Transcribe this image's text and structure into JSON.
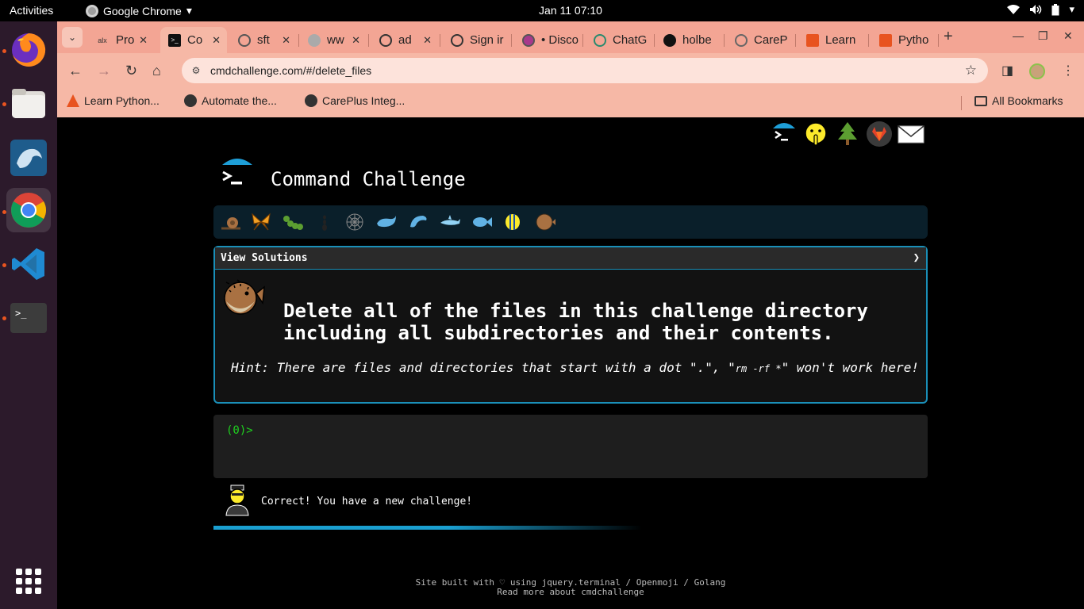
{
  "system": {
    "activities": "Activities",
    "app_name": "Google Chrome",
    "clock": "Jan 11  07:10"
  },
  "browser": {
    "tabs": [
      {
        "title": "Pro",
        "favicon": "alx-icon"
      },
      {
        "title": "Co",
        "favicon": "terminal-icon",
        "active": true
      },
      {
        "title": "sft",
        "favicon": "globe-icon"
      },
      {
        "title": "ww",
        "favicon": "globe-icon"
      },
      {
        "title": "ad",
        "favicon": "github-copilot-icon"
      },
      {
        "title": "Sign ir",
        "favicon": "github-copilot-icon"
      },
      {
        "title": "• Disco",
        "favicon": "discord-icon"
      },
      {
        "title": "ChatG",
        "favicon": "chatgpt-icon"
      },
      {
        "title": "holbe",
        "favicon": "github-icon"
      },
      {
        "title": "CareP",
        "favicon": "carepoint-icon"
      },
      {
        "title": "Learn",
        "favicon": "alx-flame-icon"
      },
      {
        "title": "Pytho",
        "favicon": "alx-flame-icon"
      }
    ],
    "url": "cmdchallenge.com/#/delete_files",
    "bookmarks": [
      {
        "label": "Learn Python...",
        "icon": "flame-icon"
      },
      {
        "label": "Automate the...",
        "icon": "globe-icon"
      },
      {
        "label": "CarePlus Integ...",
        "icon": "globe-icon"
      }
    ],
    "all_bookmarks": "All Bookmarks"
  },
  "page": {
    "site_title": "Command Challenge",
    "view_solutions": "View Solutions",
    "chevron": "❯",
    "task_line1": "Delete all of the files in this challenge directory",
    "task_line2": "including all subdirectories and their contents.",
    "hint_prefix": "Hint: There are files and directories that start with a dot \".\", \"",
    "hint_code": "rm -rf *",
    "hint_suffix": "\" won't work here!",
    "prompt": "(0)>",
    "message": "Correct! You have a new challenge!",
    "footer_line1": "Site built with ♡ using jquery.terminal / Openmoji / Golang",
    "footer_line2": "Read more about cmdchallenge",
    "progress": 0.6
  }
}
